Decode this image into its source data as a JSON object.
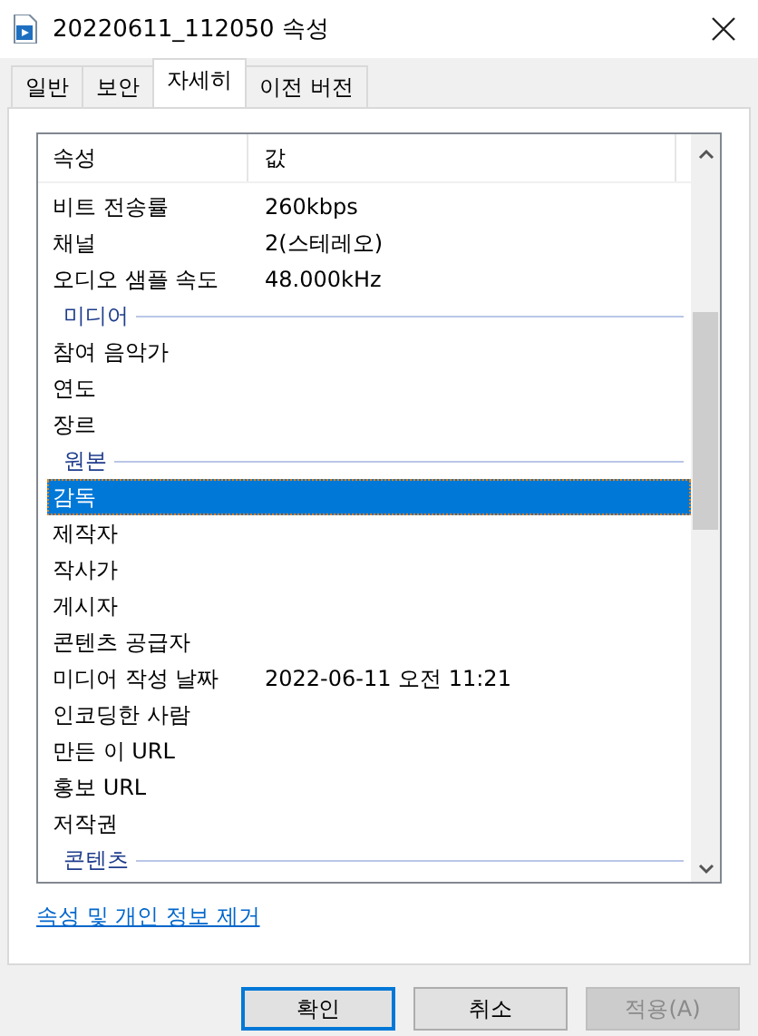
{
  "window": {
    "title": "20220611_112050 속성"
  },
  "tabs": [
    {
      "label": "일반",
      "selected": false
    },
    {
      "label": "보안",
      "selected": false
    },
    {
      "label": "자세히",
      "selected": true
    },
    {
      "label": "이전 버전",
      "selected": false
    }
  ],
  "table": {
    "columns": [
      "속성",
      "값"
    ],
    "rows": [
      {
        "kind": "row",
        "name": "비트 전송률",
        "value": "260kbps",
        "selected": false
      },
      {
        "kind": "row",
        "name": "채널",
        "value": "2(스테레오)",
        "selected": false
      },
      {
        "kind": "row",
        "name": "오디오 샘플 속도",
        "value": "48.000kHz",
        "selected": false
      },
      {
        "kind": "group",
        "name": "미디어"
      },
      {
        "kind": "row",
        "name": "참여 음악가",
        "selected": false
      },
      {
        "kind": "row",
        "name": "연도",
        "selected": false
      },
      {
        "kind": "row",
        "name": "장르",
        "selected": false
      },
      {
        "kind": "group",
        "name": "원본"
      },
      {
        "kind": "row",
        "name": "감독",
        "selected": true
      },
      {
        "kind": "row",
        "name": "제작자",
        "selected": false
      },
      {
        "kind": "row",
        "name": "작사가",
        "selected": false
      },
      {
        "kind": "row",
        "name": "게시자",
        "selected": false
      },
      {
        "kind": "row",
        "name": "콘텐츠 공급자",
        "selected": false
      },
      {
        "kind": "row",
        "name": "미디어 작성 날짜",
        "value": "2022-06-11 오전 11:21",
        "selected": false
      },
      {
        "kind": "row",
        "name": "인코딩한 사람",
        "selected": false
      },
      {
        "kind": "row",
        "name": "만든 이 URL",
        "selected": false
      },
      {
        "kind": "row",
        "name": "홍보 URL",
        "selected": false
      },
      {
        "kind": "row",
        "name": "저작권",
        "selected": false
      },
      {
        "kind": "group",
        "name": "콘텐츠"
      }
    ]
  },
  "link": "속성 및 개인 정보 제거",
  "buttons": [
    {
      "label": "확인",
      "kind": "default",
      "disabled": false
    },
    {
      "label": "취소",
      "kind": "normal",
      "disabled": false
    },
    {
      "label": "적용(A)",
      "kind": "normal",
      "disabled": true
    }
  ]
}
